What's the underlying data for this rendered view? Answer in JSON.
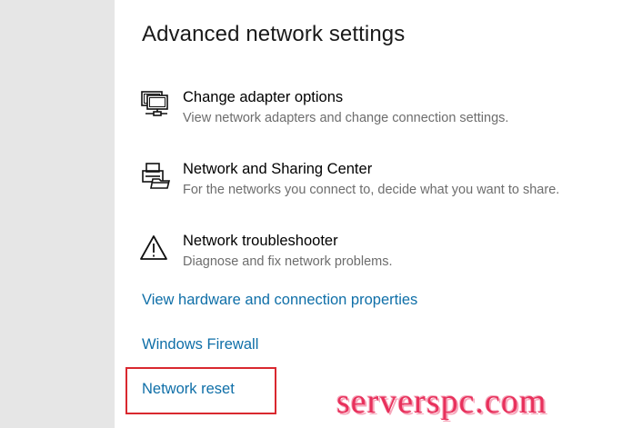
{
  "section": {
    "title": "Advanced network settings"
  },
  "items": [
    {
      "icon": "network-adapter-icon",
      "title": "Change adapter options",
      "description": "View network adapters and change connection settings."
    },
    {
      "icon": "sharing-center-icon",
      "title": "Network and Sharing Center",
      "description": "For the networks you connect to, decide what you want to share."
    },
    {
      "icon": "warning-triangle-icon",
      "title": "Network troubleshooter",
      "description": "Diagnose and fix network problems."
    }
  ],
  "links": {
    "hardware_properties": "View hardware and connection properties",
    "windows_firewall": "Windows Firewall",
    "network_reset": "Network reset"
  },
  "highlight_color": "#d9282f",
  "link_color": "#0f6fa8",
  "watermark": "serverspc.com"
}
